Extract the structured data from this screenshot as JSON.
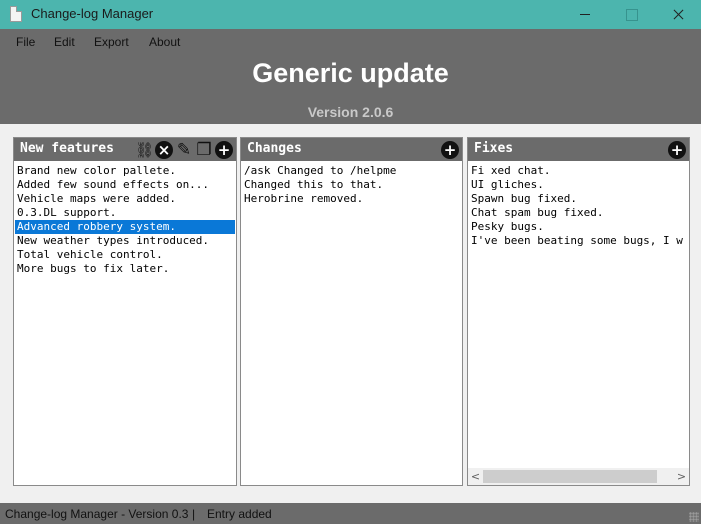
{
  "window": {
    "title": "Change-log Manager",
    "icon": "document-icon"
  },
  "menu": {
    "items": [
      "File",
      "Edit",
      "Export",
      "About"
    ]
  },
  "header": {
    "title": "Generic update",
    "version": "Version 2.0.6"
  },
  "panels": {
    "new_features": {
      "title": "New features",
      "icons": [
        "link-icon",
        "delete-icon",
        "edit-icon",
        "copy-icon",
        "add-icon"
      ],
      "items": [
        "Brand new color pallete.",
        "Added few sound effects on...",
        "Vehicle maps were added.",
        "0.3.DL support.",
        "Advanced robbery system.",
        "New weather types introduced.",
        "Total vehicle control.",
        "More bugs to fix later."
      ],
      "selected_index": 4
    },
    "changes": {
      "title": "Changes",
      "icons": [
        "add-icon"
      ],
      "items": [
        "/ask Changed to /helpme",
        "Changed this to that.",
        "Herobrine removed."
      ]
    },
    "fixes": {
      "title": "Fixes",
      "icons": [
        "add-icon"
      ],
      "items": [
        "Fi xed chat.",
        "UI gliches.",
        "Spawn bug fixed.",
        "Chat spam bug fixed.",
        "Pesky bugs.",
        "I've been beating some bugs, I w"
      ]
    }
  },
  "status": {
    "app": "Change-log Manager - Version 0.3",
    "separator": "|",
    "message": "Entry added"
  },
  "colors": {
    "titlebar": "#4cb5ae",
    "chrome": "#6b6b6b",
    "selection": "#0a78d7",
    "version_text": "#c9c9c9"
  }
}
